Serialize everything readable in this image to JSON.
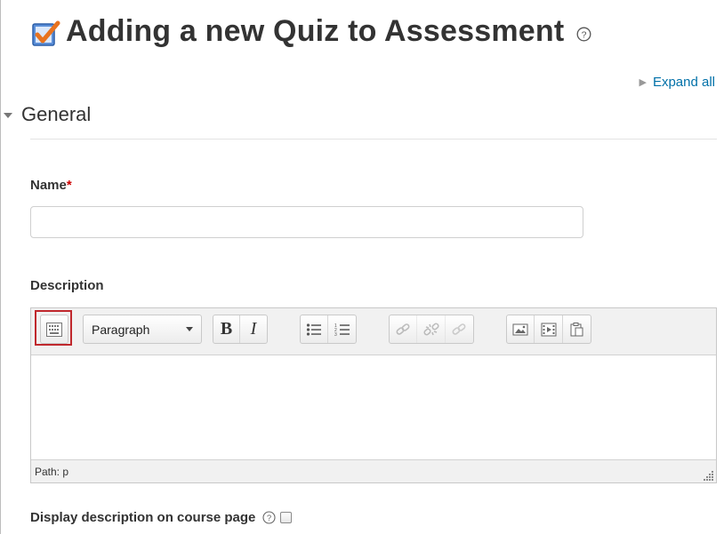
{
  "page": {
    "heading": "Adding a new Quiz to Assessment",
    "expand_all": "Expand all"
  },
  "section": {
    "title": "General"
  },
  "name_field": {
    "label": "Name",
    "required_marker": "*",
    "value": ""
  },
  "description_field": {
    "label": "Description",
    "toolbar": {
      "format_select": "Paragraph",
      "bold_label": "B",
      "italic_label": "I"
    },
    "content": "",
    "path": "Path: p"
  },
  "display_description": {
    "label": "Display description on course page",
    "checked": false
  },
  "colors": {
    "link": "#0070a8",
    "required": "#cc0000",
    "highlight": "#c0282d"
  },
  "icons": [
    "quiz-icon",
    "help-icon",
    "toolbar-toggle-icon",
    "unordered-list-icon",
    "ordered-list-icon",
    "link-icon",
    "unlink-icon",
    "anchor-icon",
    "image-icon",
    "media-icon",
    "paste-icon",
    "resize-icon"
  ]
}
